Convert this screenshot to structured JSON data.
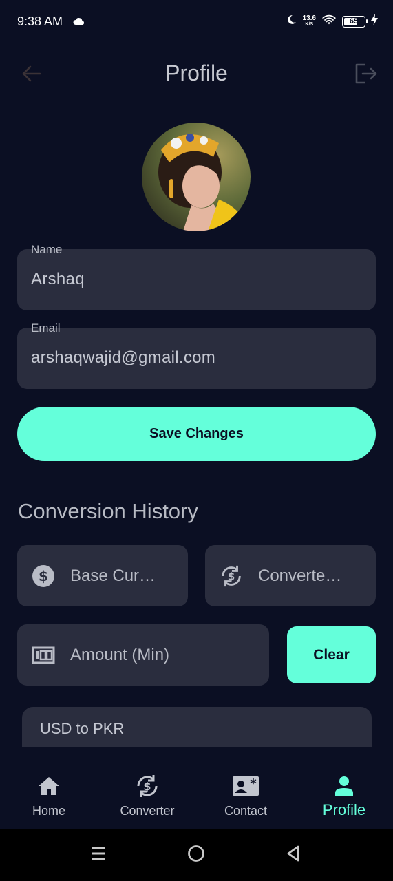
{
  "status_bar": {
    "time": "9:38 AM",
    "net_speed_value": "13.6",
    "net_speed_unit": "K/S",
    "battery_level": "65",
    "icons": [
      "cloud-icon",
      "moon-icon",
      "wifi-icon",
      "battery-icon",
      "charging-icon"
    ]
  },
  "header": {
    "title": "Profile",
    "back_icon": "arrow-left-icon",
    "logout_icon": "logout-icon"
  },
  "profile": {
    "name_label": "Name",
    "name_value": "Arshaq",
    "email_label": "Email",
    "email_value": "arshaqwajid@gmail.com",
    "save_label": "Save Changes"
  },
  "history": {
    "title": "Conversion History",
    "base_currency_label": "Base Cur…",
    "converted_label": "Converte…",
    "amount_label": "Amount (Min)",
    "clear_label": "Clear",
    "items": [
      {
        "title": "USD to PKR"
      }
    ]
  },
  "bottom_nav": {
    "items": [
      {
        "label": "Home",
        "icon": "home-icon",
        "active": false
      },
      {
        "label": "Converter",
        "icon": "currency-exchange-icon",
        "active": false
      },
      {
        "label": "Contact",
        "icon": "contact-card-icon",
        "active": false
      },
      {
        "label": "Profile",
        "icon": "person-icon",
        "active": true
      }
    ]
  },
  "colors": {
    "background": "#0b0f23",
    "surface": "#2a2d3e",
    "accent": "#64ffda",
    "text_muted": "#b9bcc6"
  }
}
